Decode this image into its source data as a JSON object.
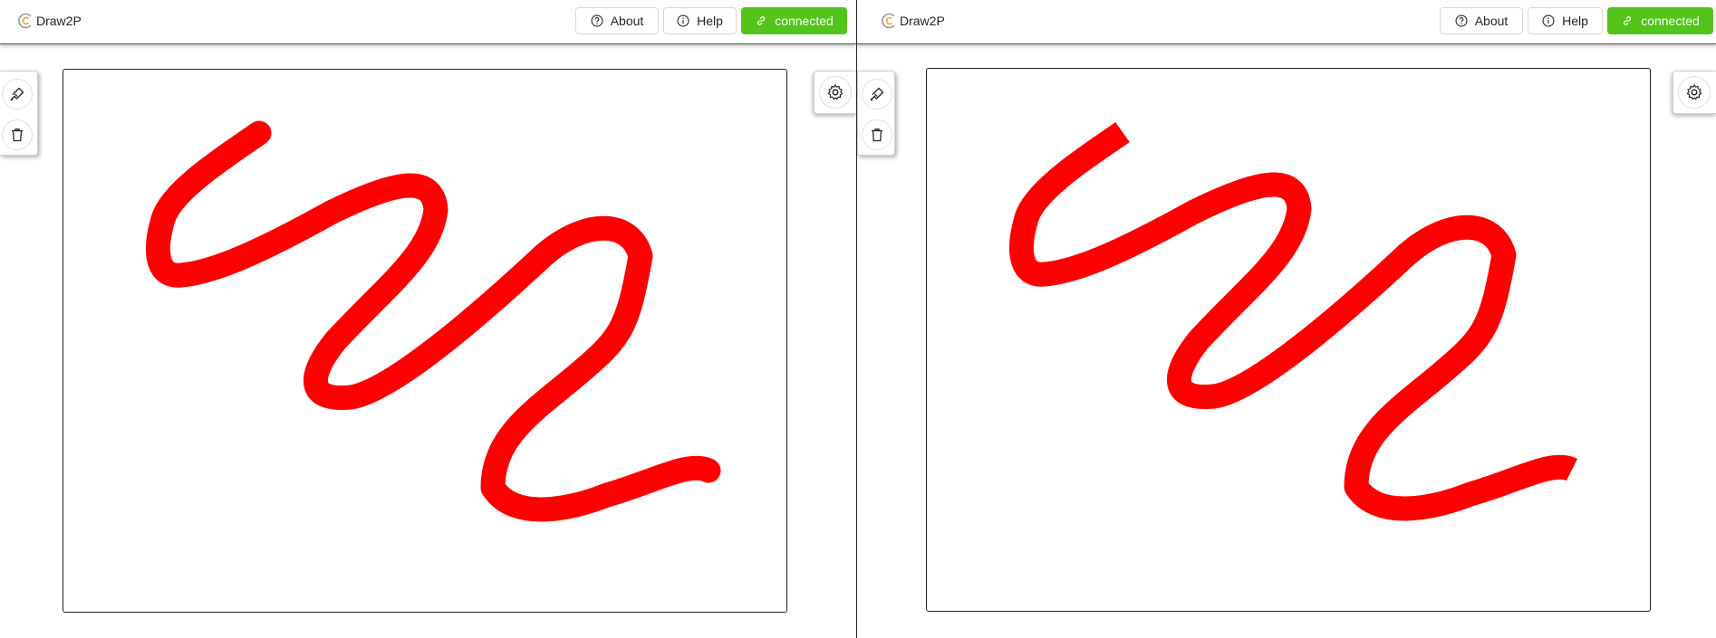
{
  "app": {
    "name": "Draw2P"
  },
  "header": {
    "about_label": "About",
    "help_label": "Help",
    "connection_label": "connected"
  },
  "toolbar": {
    "tools": [
      "brush-icon",
      "trash-icon"
    ],
    "settings_icon": "gear-icon"
  },
  "colors": {
    "stroke": "#ff0000",
    "connected": "#52c41a",
    "logo_accent": "#f5a623"
  },
  "panes": [
    "left-client",
    "right-client"
  ]
}
